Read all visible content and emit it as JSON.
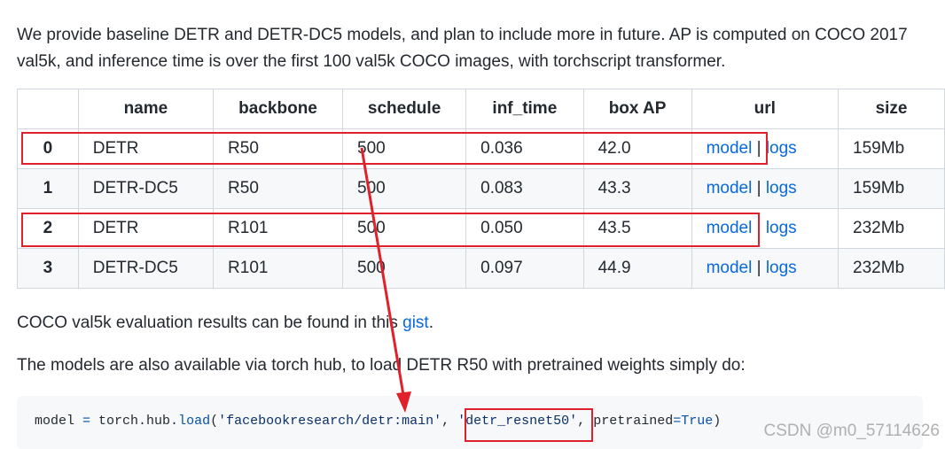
{
  "intro": {
    "text": "We provide baseline DETR and DETR-DC5 models, and plan to include more in future. AP is computed on COCO 2017 val5k, and inference time is over the first 100 val5k COCO images, with torchscript transformer."
  },
  "table": {
    "headers": [
      "",
      "name",
      "backbone",
      "schedule",
      "inf_time",
      "box AP",
      "url",
      "size"
    ],
    "rows": [
      {
        "idx": "0",
        "name": "DETR",
        "backbone": "R50",
        "schedule": "500",
        "inf_time": "0.036",
        "box_ap": "42.0",
        "model": "model",
        "sep": " | ",
        "logs": "logs",
        "size": "159Mb"
      },
      {
        "idx": "1",
        "name": "DETR-DC5",
        "backbone": "R50",
        "schedule": "500",
        "inf_time": "0.083",
        "box_ap": "43.3",
        "model": "model",
        "sep": " | ",
        "logs": "logs",
        "size": "159Mb"
      },
      {
        "idx": "2",
        "name": "DETR",
        "backbone": "R101",
        "schedule": "500",
        "inf_time": "0.050",
        "box_ap": "43.5",
        "model": "model",
        "sep": " | ",
        "logs": "logs",
        "size": "232Mb"
      },
      {
        "idx": "3",
        "name": "DETR-DC5",
        "backbone": "R101",
        "schedule": "500",
        "inf_time": "0.097",
        "box_ap": "44.9",
        "model": "model",
        "sep": " | ",
        "logs": "logs",
        "size": "232Mb"
      }
    ]
  },
  "gist_line": {
    "before": "COCO val5k evaluation results can be found in this ",
    "link": "gist",
    "after": "."
  },
  "hub_line": {
    "text": "The models are also available via torch hub, to load DETR R50 with pretrained weights simply do:"
  },
  "code": {
    "t1": "model ",
    "t2": "=",
    "t3": " torch.hub.",
    "t4": "load",
    "t5": "(",
    "t6": "'facebookresearch/detr:main'",
    "t7": ", ",
    "t8": "'detr_resnet50'",
    "t9": ", pretrained",
    "t10": "=",
    "t11": "True",
    "t12": ")"
  },
  "watermark": "CSDN @m0_57114626",
  "colors": {
    "annotation_red": "#e0202a",
    "link_blue": "#0969da"
  }
}
